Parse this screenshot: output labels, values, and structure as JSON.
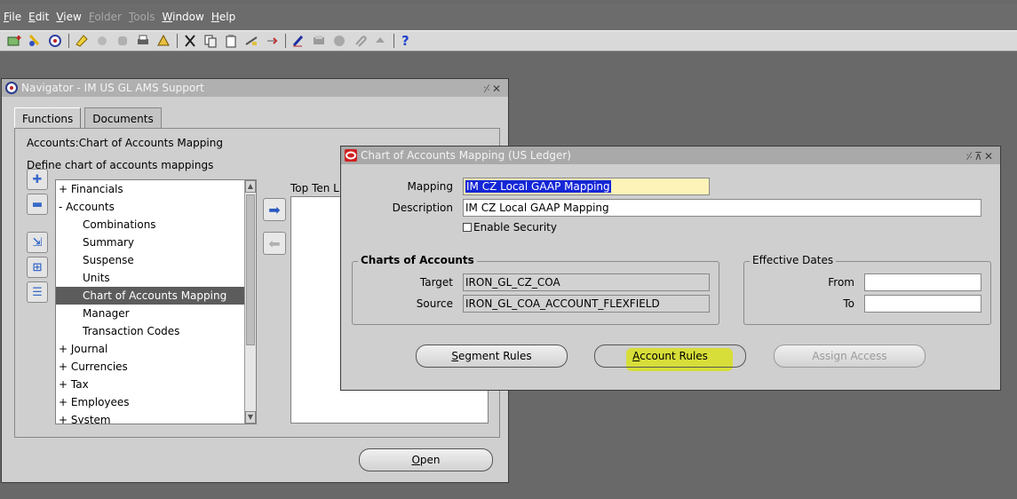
{
  "menu": [
    {
      "label": "File",
      "ul": "F",
      "rest": "ile",
      "disabled": false
    },
    {
      "label": "Edit",
      "ul": "E",
      "rest": "dit",
      "disabled": false
    },
    {
      "label": "View",
      "ul": "V",
      "rest": "iew",
      "disabled": false
    },
    {
      "label": "Folder",
      "ul": "F",
      "rest": "older",
      "disabled": true
    },
    {
      "label": "Tools",
      "ul": "T",
      "rest": "ools",
      "disabled": true
    },
    {
      "label": "Window",
      "ul": "W",
      "rest": "indow",
      "disabled": false
    },
    {
      "label": "Help",
      "ul": "H",
      "rest": "elp",
      "disabled": false
    }
  ],
  "toolbar": {
    "help_glyph": "?",
    "icons": [
      "new-icon",
      "find-icon",
      "navigator-icon",
      "save-icon",
      "next-step-icon",
      "switch-responsibility-icon",
      "print-icon",
      "close-form-icon",
      "cut-icon",
      "copy-icon",
      "paste-icon",
      "clear-record-icon",
      "delete-record-icon",
      "edit-field-icon",
      "zoom-icon",
      "translations-icon",
      "attachments-icon",
      "folder-tools-icon",
      "help-icon"
    ]
  },
  "navigator": {
    "title": "Navigator - IM US GL AMS Support",
    "tabs": [
      "Functions",
      "Documents"
    ],
    "path": "Accounts:Chart of Accounts Mapping",
    "description": "Define chart of accounts mappings",
    "tree": [
      {
        "label": "+ Financials",
        "level": 1,
        "selected": false
      },
      {
        "label": "- Accounts",
        "level": 1,
        "selected": false
      },
      {
        "label": "Combinations",
        "level": 2,
        "selected": false
      },
      {
        "label": "Summary",
        "level": 2,
        "selected": false
      },
      {
        "label": "Suspense",
        "level": 2,
        "selected": false
      },
      {
        "label": "Units",
        "level": 2,
        "selected": false
      },
      {
        "label": "Chart of Accounts Mapping",
        "level": 2,
        "selected": true
      },
      {
        "label": "Manager",
        "level": 2,
        "selected": false
      },
      {
        "label": "Transaction Codes",
        "level": 2,
        "selected": false
      },
      {
        "label": "+ Journal",
        "level": 1,
        "selected": false
      },
      {
        "label": "+ Currencies",
        "level": 1,
        "selected": false
      },
      {
        "label": "+ Tax",
        "level": 1,
        "selected": false
      },
      {
        "label": "+ Employees",
        "level": 1,
        "selected": false
      },
      {
        "label": "+ System",
        "level": 1,
        "selected": false
      }
    ],
    "top_ten_label": "Top Ten L",
    "open_label": "Open",
    "open_ul": "O",
    "open_rest": "pen"
  },
  "mapping": {
    "title": "Chart of Accounts Mapping (US Ledger)",
    "mapping_label": "Mapping",
    "mapping_value": "IM CZ Local GAAP Mapping",
    "description_label": "Description",
    "description_value": "IM CZ Local GAAP Mapping",
    "enable_security_label": "Enable Security",
    "enable_security_checked": false,
    "coa_group_title": "Charts of Accounts",
    "target_label": "Target",
    "target_value": "IRON_GL_CZ_COA",
    "source_label": "Source",
    "source_value": "IRON_GL_COA_ACCOUNT_FLEXFIELD",
    "dates_group_title": "Effective Dates",
    "from_label": "From",
    "from_value": "",
    "to_label": "To",
    "to_value": "",
    "segment_rules": {
      "ul": "S",
      "rest": "egment Rules"
    },
    "account_rules": {
      "ul": "A",
      "rest": "ccount Rules"
    },
    "assign_access": "Assign Access",
    "highlight_color": "#d8e11e"
  }
}
